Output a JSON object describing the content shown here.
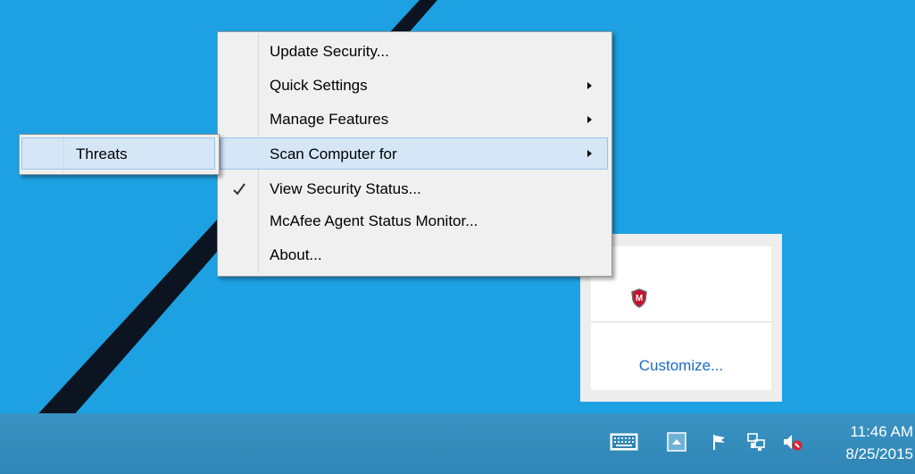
{
  "context_menu": {
    "items": [
      {
        "label": "Update Security...",
        "has_submenu": false,
        "checked": false,
        "highlighted": false
      },
      {
        "label": "Quick Settings",
        "has_submenu": true,
        "checked": false,
        "highlighted": false
      },
      {
        "label": "Manage Features",
        "has_submenu": true,
        "checked": false,
        "highlighted": false
      },
      {
        "label": "Scan Computer for",
        "has_submenu": true,
        "checked": false,
        "highlighted": true
      },
      {
        "label": "View Security Status...",
        "has_submenu": false,
        "checked": true,
        "highlighted": false
      },
      {
        "label": "McAfee Agent Status Monitor...",
        "has_submenu": false,
        "checked": false,
        "highlighted": false
      },
      {
        "label": "About...",
        "has_submenu": false,
        "checked": false,
        "highlighted": false
      }
    ]
  },
  "submenu": {
    "items": [
      {
        "label": "Threats",
        "highlighted": true
      }
    ]
  },
  "tray_popup": {
    "icons": [
      "mcafee-shield-icon"
    ],
    "customize_label": "Customize..."
  },
  "taskbar": {
    "tray_icons": [
      "touch-keyboard-icon",
      "show-hidden-icons-chevron-icon",
      "action-center-flag-icon",
      "network-icon",
      "volume-muted-icon"
    ],
    "clock": {
      "time": "11:46 AM",
      "date": "8/25/2015"
    }
  },
  "colors": {
    "desktop": "#1da1e2",
    "taskbar": "#3a93c2",
    "menu_background": "#f0f0f0",
    "menu_highlight": "#d5e6f7",
    "link": "#1a6bc4"
  }
}
